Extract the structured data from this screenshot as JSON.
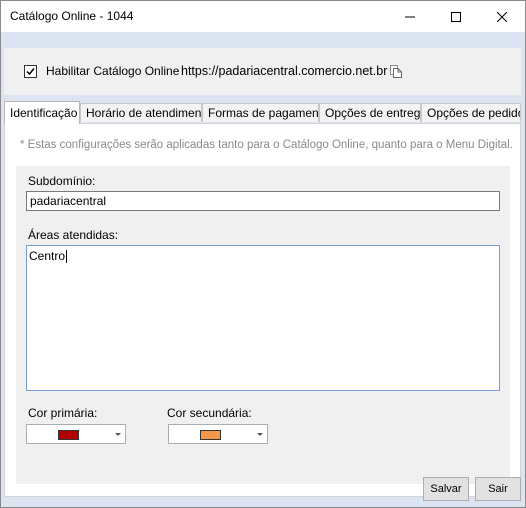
{
  "window": {
    "title": "Catálogo Online - 1044"
  },
  "header": {
    "enable_label": "Habilitar Catálogo Online",
    "enable_checked": true,
    "url": "https://padariacentral.comercio.net.br"
  },
  "tabs": [
    {
      "label": "Identificação",
      "active": true
    },
    {
      "label": "Horário de atendimento",
      "active": false
    },
    {
      "label": "Formas de pagamento",
      "active": false
    },
    {
      "label": "Opções de entrega",
      "active": false
    },
    {
      "label": "Opções de pedido",
      "active": false
    }
  ],
  "panel": {
    "hint": "* Estas configurações serão aplicadas tanto para o Catálogo Online, quanto para o Menu Digital.",
    "subdomain_label": "Subdomínio:",
    "subdomain_value": "padariacentral",
    "areas_label": "Áreas atendidas:",
    "areas_value": "Centro",
    "primary_color_label": "Cor primária:",
    "primary_color": "#b00000",
    "secondary_color_label": "Cor secundária:",
    "secondary_color": "#f5974a"
  },
  "buttons": {
    "save": "Salvar",
    "exit": "Sair"
  }
}
